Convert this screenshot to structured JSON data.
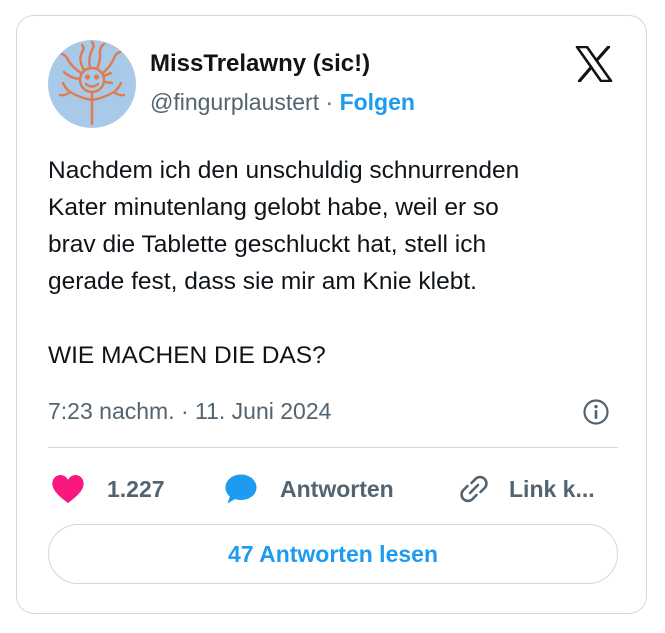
{
  "author": {
    "display_name": "MissTrelawny (sic!)",
    "handle": "@fingurplaustert",
    "separator": " · ",
    "follow_label": "Folgen"
  },
  "tweet": {
    "text": "Nachdem ich den unschuldig schnurrenden\nKater minutenlang gelobt habe, weil er so\nbrav die Tablette geschluckt hat, stell ich\ngerade fest, dass sie mir am Knie klebt.\n\nWIE MACHEN DIE DAS?",
    "timestamp": "7:23 nachm. · 11. Juni 2024"
  },
  "actions": {
    "like_count": "1.227",
    "reply_label": "Antworten",
    "link_label": "Link k..."
  },
  "read_replies_label": "47 Antworten lesen",
  "icons": {
    "brand": "x-logo-icon",
    "info": "info-icon",
    "like": "heart-icon",
    "reply": "speech-bubble-icon",
    "link": "link-icon"
  },
  "colors": {
    "accent": "#1d9bf0",
    "like": "#f91880",
    "text": "#0f1419",
    "muted": "#536471",
    "border": "#cfd9de",
    "avatar_bg": "#a9c9e9",
    "avatar_drawing": "#e07b4f"
  }
}
